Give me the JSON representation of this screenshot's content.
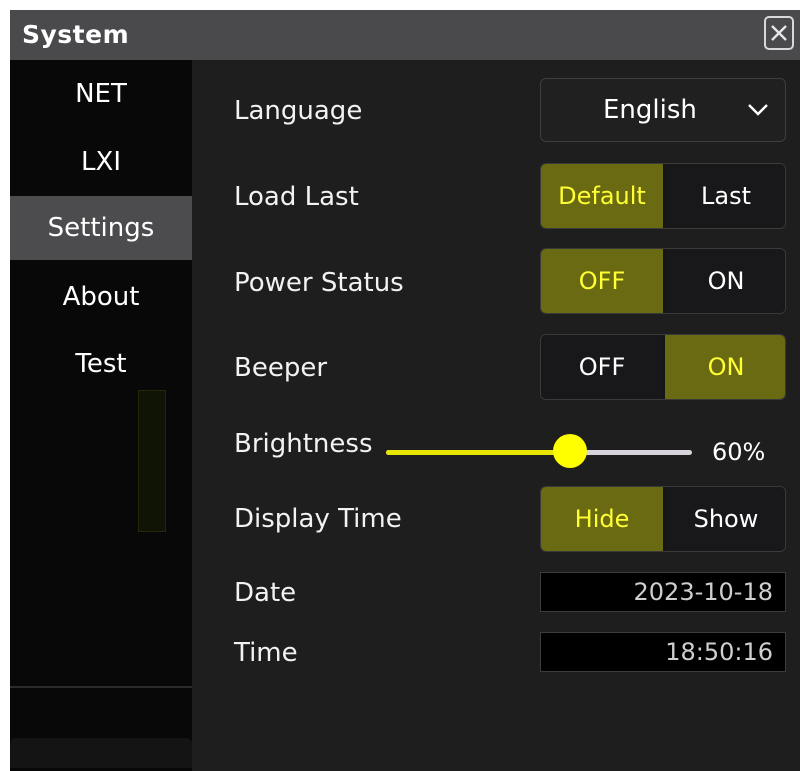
{
  "window": {
    "title": "System"
  },
  "sidebar": {
    "items": [
      {
        "label": "NET",
        "active": false
      },
      {
        "label": "LXI",
        "active": false
      },
      {
        "label": "Settings",
        "active": true
      },
      {
        "label": "About",
        "active": false
      },
      {
        "label": "Test",
        "active": false
      }
    ]
  },
  "settings": {
    "language": {
      "label": "Language",
      "value": "English"
    },
    "load_last": {
      "label": "Load Last",
      "options": [
        "Default",
        "Last"
      ],
      "selected": "Default"
    },
    "power_status": {
      "label": "Power Status",
      "options": [
        "OFF",
        "ON"
      ],
      "selected": "OFF"
    },
    "beeper": {
      "label": "Beeper",
      "options": [
        "OFF",
        "ON"
      ],
      "selected": "ON"
    },
    "brightness": {
      "label": "Brightness",
      "value": 60,
      "display": "60%"
    },
    "display_time": {
      "label": "Display Time",
      "options": [
        "Hide",
        "Show"
      ],
      "selected": "Hide"
    },
    "date": {
      "label": "Date",
      "value": "2023-10-18"
    },
    "time": {
      "label": "Time",
      "value": "18:50:16"
    }
  },
  "colors": {
    "accent_fill": "#6a6a12",
    "accent_text": "#ffff33",
    "slider": "#e6e600",
    "panel": "#1e1e1f",
    "sidebar": "#080808",
    "titlebar": "#4a4a4c"
  },
  "icons": {
    "close": "close-icon",
    "dropdown": "chevron-down-icon"
  }
}
